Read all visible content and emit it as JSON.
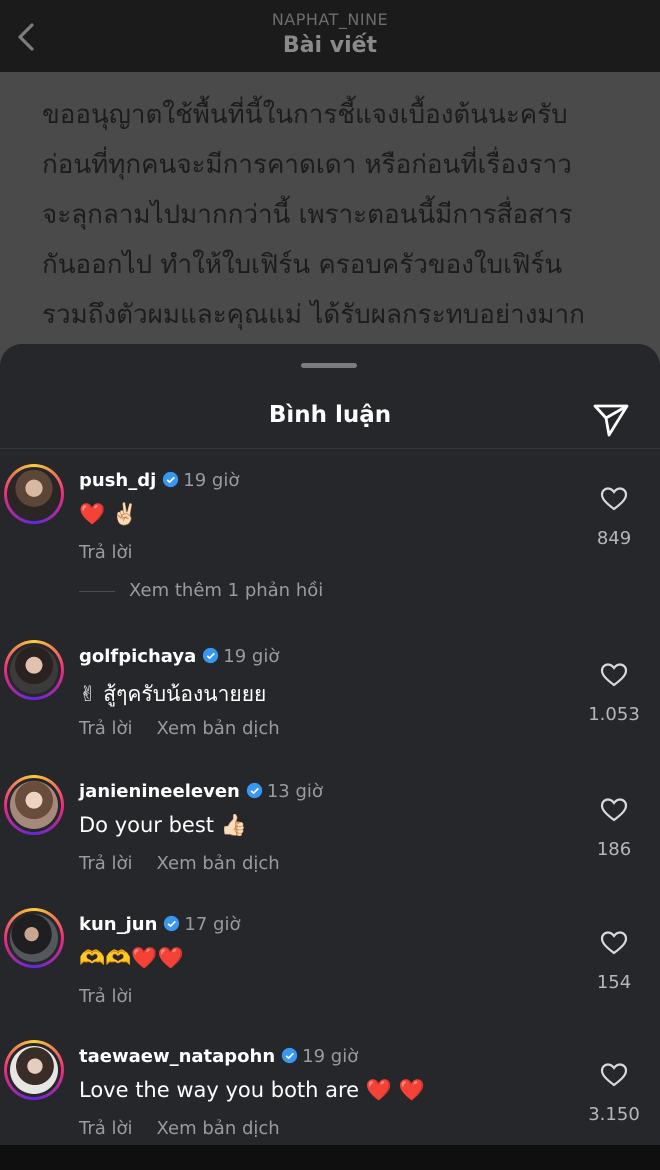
{
  "header": {
    "username": "NAPHAT_NINE",
    "title": "Bài viết"
  },
  "post": {
    "lines": [
      "ขออนุญาตใช้พื้นที่นี้ในการชี้แจงเบื้องต้นนะครับ",
      "ก่อนที่ทุกคนจะมีการคาดเดา  หรือก่อนที่เรื่องราว",
      "จะลุกลามไปมากกว่านี้ เพราะตอนนี้มีการสื่อสาร",
      "กันออกไป ทำให้ใบเฟิร์น ครอบครัวของใบเฟิร์น",
      "รวมถึงตัวผมและคุณแม่ ได้รับผลกระทบอย่างมาก"
    ]
  },
  "sheet": {
    "title": "Bình luận",
    "reply_label": "Trả lời",
    "translate_label": "Xem bản dịch",
    "more_replies": "Xem thêm 1 phản hồi"
  },
  "comments": [
    {
      "username": "push_dj",
      "time": "19 giờ",
      "text": "❤️ ✌🏻",
      "likes": "849",
      "translate": false
    },
    {
      "username": "golfpichaya",
      "time": "19 giờ",
      "text": "✌ สู้ๆครับน้องนายยย",
      "likes": "1.053",
      "translate": true
    },
    {
      "username": "janienineeleven",
      "time": "13 giờ",
      "text": "Do your best 👍🏻",
      "likes": "186",
      "translate": true
    },
    {
      "username": "kun_jun",
      "time": "17 giờ",
      "text": "🫶🫶❤️❤️",
      "likes": "154",
      "translate": false
    },
    {
      "username": "taewaew_natapohn",
      "time": "19 giờ",
      "text": "Love the way you both are ❤️ ❤️",
      "likes": "3.150",
      "translate": true
    }
  ],
  "colors": {
    "sheet_bg": "#25272b",
    "verified": "#3897f0",
    "muted_text": "#9a9ba0"
  }
}
